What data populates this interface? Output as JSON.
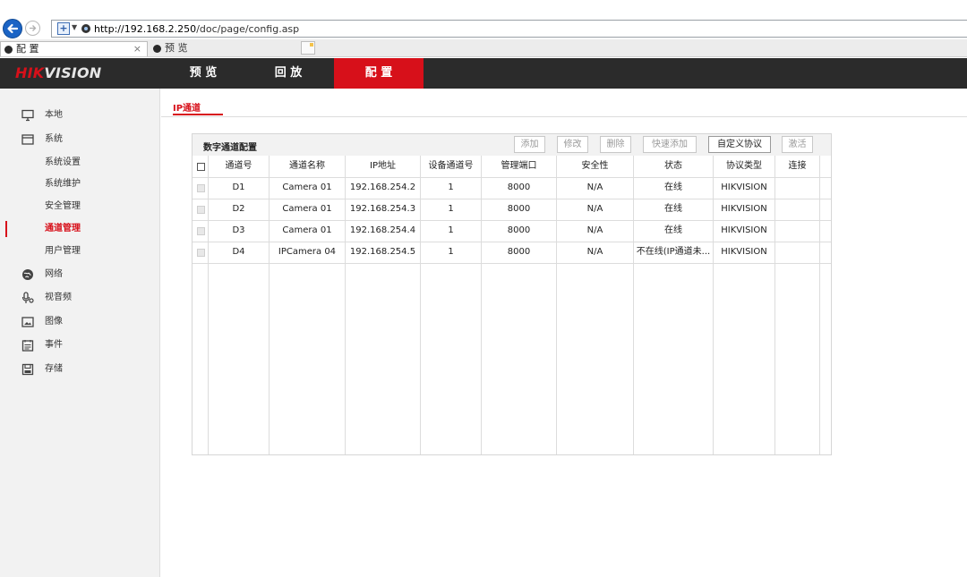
{
  "browser": {
    "url_host": "http://192.168.2.250",
    "url_path": "/doc/page/config.asp",
    "tabs": [
      {
        "label": "配 置",
        "close": "×"
      },
      {
        "label": "预 览"
      }
    ]
  },
  "header": {
    "logo_red": "HIK",
    "logo_rest": "VISION",
    "nav": [
      {
        "label": "预 览"
      },
      {
        "label": "回 放"
      },
      {
        "label": "配 置"
      }
    ],
    "colors": {
      "accent": "#d7101a",
      "header_bg": "#2b2b2b"
    }
  },
  "sidebar": {
    "items": [
      {
        "label": "本地",
        "icon": "monitor-icon"
      },
      {
        "label": "系统",
        "icon": "system-icon"
      },
      {
        "label": "系统设置"
      },
      {
        "label": "系统维护"
      },
      {
        "label": "安全管理"
      },
      {
        "label": "通道管理"
      },
      {
        "label": "用户管理"
      },
      {
        "label": "网络",
        "icon": "network-globe-icon"
      },
      {
        "label": "视音频",
        "icon": "audio-video-icon"
      },
      {
        "label": "图像",
        "icon": "image-icon"
      },
      {
        "label": "事件",
        "icon": "event-icon"
      },
      {
        "label": "存储",
        "icon": "storage-icon"
      }
    ]
  },
  "content": {
    "subtab": "IP通道",
    "panel_title": "数字通道配置",
    "buttons": {
      "add": "添加",
      "modify": "修改",
      "delete": "删除",
      "quick_add": "快速添加",
      "custom_protocol": "自定义协议",
      "activate": "激活"
    },
    "columns": [
      "通道号",
      "通道名称",
      "IP地址",
      "设备通道号",
      "管理端口",
      "安全性",
      "状态",
      "协议类型",
      "连接"
    ],
    "rows": [
      [
        "D1",
        "Camera 01",
        "192.168.254.2",
        "1",
        "8000",
        "N/A",
        "在线",
        "HIKVISION",
        ""
      ],
      [
        "D2",
        "Camera 01",
        "192.168.254.3",
        "1",
        "8000",
        "N/A",
        "在线",
        "HIKVISION",
        ""
      ],
      [
        "D3",
        "Camera 01",
        "192.168.254.4",
        "1",
        "8000",
        "N/A",
        "在线",
        "HIKVISION",
        ""
      ],
      [
        "D4",
        "IPCamera 04",
        "192.168.254.5",
        "1",
        "8000",
        "N/A",
        "不在线(IP通道未...",
        "HIKVISION",
        ""
      ]
    ]
  }
}
